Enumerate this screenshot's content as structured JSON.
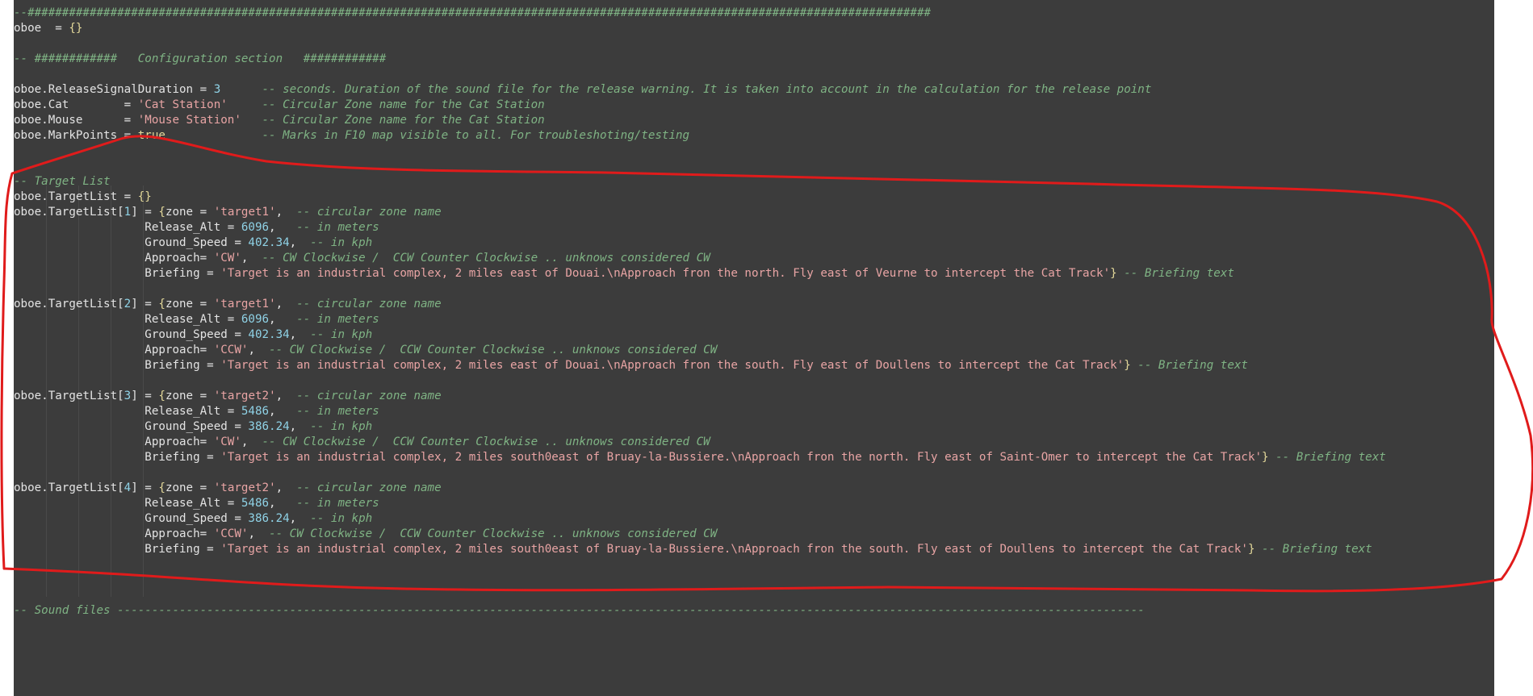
{
  "editor": {
    "lines": [
      [
        {
          "c": "hd",
          "t": "--###################################################################################################################################"
        }
      ],
      [
        {
          "c": "i",
          "t": "oboe  = "
        },
        {
          "c": "k",
          "t": "{}"
        }
      ],
      [
        {
          "c": "i",
          "t": ""
        }
      ],
      [
        {
          "c": "hd",
          "t": "-- ############   Configuration section   ############"
        }
      ],
      [
        {
          "c": "i",
          "t": ""
        }
      ],
      [
        {
          "c": "i",
          "t": "oboe.ReleaseSignalDuration = "
        },
        {
          "c": "n",
          "t": "3"
        },
        {
          "c": "i",
          "t": "      "
        },
        {
          "c": "c",
          "t": "-- seconds. Duration of the sound file for the release warning. It is taken into account in the calculation for the release point"
        }
      ],
      [
        {
          "c": "i",
          "t": "oboe.Cat        = "
        },
        {
          "c": "s",
          "t": "'Cat Station'"
        },
        {
          "c": "i",
          "t": "     "
        },
        {
          "c": "c",
          "t": "-- Circular Zone name for the Cat Station"
        }
      ],
      [
        {
          "c": "i",
          "t": "oboe.Mouse      = "
        },
        {
          "c": "s",
          "t": "'Mouse Station'"
        },
        {
          "c": "i",
          "t": "   "
        },
        {
          "c": "c",
          "t": "-- Circular Zone name for the Cat Station"
        }
      ],
      [
        {
          "c": "i",
          "t": "oboe.MarkPoints = "
        },
        {
          "c": "k",
          "t": "true"
        },
        {
          "c": "i",
          "t": "              "
        },
        {
          "c": "c",
          "t": "-- Marks in F10 map visible to all. For troubleshoting/testing"
        }
      ],
      [
        {
          "c": "i",
          "t": ""
        }
      ],
      [
        {
          "c": "i",
          "t": ""
        }
      ],
      [
        {
          "c": "c",
          "t": "-- Target List"
        }
      ],
      [
        {
          "c": "i",
          "t": "oboe.TargetList = "
        },
        {
          "c": "k",
          "t": "{}"
        }
      ],
      [
        {
          "c": "i",
          "t": "oboe.TargetList["
        },
        {
          "c": "n",
          "t": "1"
        },
        {
          "c": "i",
          "t": "] = "
        },
        {
          "c": "k",
          "t": "{"
        },
        {
          "c": "i",
          "t": "zone = "
        },
        {
          "c": "s",
          "t": "'target1'"
        },
        {
          "c": "i",
          "t": ",  "
        },
        {
          "c": "c",
          "t": "-- circular zone name"
        }
      ],
      [
        {
          "c": "i",
          "t": "                   Release_Alt = "
        },
        {
          "c": "n",
          "t": "6096"
        },
        {
          "c": "i",
          "t": ",   "
        },
        {
          "c": "c",
          "t": "-- in meters"
        }
      ],
      [
        {
          "c": "i",
          "t": "                   Ground_Speed = "
        },
        {
          "c": "n",
          "t": "402.34"
        },
        {
          "c": "i",
          "t": ",  "
        },
        {
          "c": "c",
          "t": "-- in kph"
        }
      ],
      [
        {
          "c": "i",
          "t": "                   Approach= "
        },
        {
          "c": "s",
          "t": "'CW'"
        },
        {
          "c": "i",
          "t": ",  "
        },
        {
          "c": "c",
          "t": "-- CW Clockwise /  CCW Counter Clockwise .. unknows considered CW"
        }
      ],
      [
        {
          "c": "i",
          "t": "                   Briefing = "
        },
        {
          "c": "s",
          "t": "'Target is an industrial complex, 2 miles east of Douai.\\nApproach fron the north. Fly east of Veurne to intercept the Cat Track'"
        },
        {
          "c": "k",
          "t": "}"
        },
        {
          "c": "i",
          "t": " "
        },
        {
          "c": "c",
          "t": "-- Briefing text"
        }
      ],
      [
        {
          "c": "i",
          "t": ""
        }
      ],
      [
        {
          "c": "i",
          "t": "oboe.TargetList["
        },
        {
          "c": "n",
          "t": "2"
        },
        {
          "c": "i",
          "t": "] = "
        },
        {
          "c": "k",
          "t": "{"
        },
        {
          "c": "i",
          "t": "zone = "
        },
        {
          "c": "s",
          "t": "'target1'"
        },
        {
          "c": "i",
          "t": ",  "
        },
        {
          "c": "c",
          "t": "-- circular zone name"
        }
      ],
      [
        {
          "c": "i",
          "t": "                   Release_Alt = "
        },
        {
          "c": "n",
          "t": "6096"
        },
        {
          "c": "i",
          "t": ",   "
        },
        {
          "c": "c",
          "t": "-- in meters"
        }
      ],
      [
        {
          "c": "i",
          "t": "                   Ground_Speed = "
        },
        {
          "c": "n",
          "t": "402.34"
        },
        {
          "c": "i",
          "t": ",  "
        },
        {
          "c": "c",
          "t": "-- in kph"
        }
      ],
      [
        {
          "c": "i",
          "t": "                   Approach= "
        },
        {
          "c": "s",
          "t": "'CCW'"
        },
        {
          "c": "i",
          "t": ",  "
        },
        {
          "c": "c",
          "t": "-- CW Clockwise /  CCW Counter Clockwise .. unknows considered CW"
        }
      ],
      [
        {
          "c": "i",
          "t": "                   Briefing = "
        },
        {
          "c": "s",
          "t": "'Target is an industrial complex, 2 miles east of Douai.\\nApproach fron the south. Fly east of Doullens to intercept the Cat Track'"
        },
        {
          "c": "k",
          "t": "}"
        },
        {
          "c": "i",
          "t": " "
        },
        {
          "c": "c",
          "t": "-- Briefing text"
        }
      ],
      [
        {
          "c": "i",
          "t": ""
        }
      ],
      [
        {
          "c": "i",
          "t": "oboe.TargetList["
        },
        {
          "c": "n",
          "t": "3"
        },
        {
          "c": "i",
          "t": "] = "
        },
        {
          "c": "k",
          "t": "{"
        },
        {
          "c": "i",
          "t": "zone = "
        },
        {
          "c": "s",
          "t": "'target2'"
        },
        {
          "c": "i",
          "t": ",  "
        },
        {
          "c": "c",
          "t": "-- circular zone name"
        }
      ],
      [
        {
          "c": "i",
          "t": "                   Release_Alt = "
        },
        {
          "c": "n",
          "t": "5486"
        },
        {
          "c": "i",
          "t": ",   "
        },
        {
          "c": "c",
          "t": "-- in meters"
        }
      ],
      [
        {
          "c": "i",
          "t": "                   Ground_Speed = "
        },
        {
          "c": "n",
          "t": "386.24"
        },
        {
          "c": "i",
          "t": ",  "
        },
        {
          "c": "c",
          "t": "-- in kph"
        }
      ],
      [
        {
          "c": "i",
          "t": "                   Approach= "
        },
        {
          "c": "s",
          "t": "'CW'"
        },
        {
          "c": "i",
          "t": ",  "
        },
        {
          "c": "c",
          "t": "-- CW Clockwise /  CCW Counter Clockwise .. unknows considered CW"
        }
      ],
      [
        {
          "c": "i",
          "t": "                   Briefing = "
        },
        {
          "c": "s",
          "t": "'Target is an industrial complex, 2 miles south0east of Bruay-la-Bussiere.\\nApproach fron the north. Fly east of Saint-Omer to intercept the Cat Track'"
        },
        {
          "c": "k",
          "t": "}"
        },
        {
          "c": "i",
          "t": " "
        },
        {
          "c": "c",
          "t": "-- Briefing text"
        }
      ],
      [
        {
          "c": "i",
          "t": ""
        }
      ],
      [
        {
          "c": "i",
          "t": "oboe.TargetList["
        },
        {
          "c": "n",
          "t": "4"
        },
        {
          "c": "i",
          "t": "] = "
        },
        {
          "c": "k",
          "t": "{"
        },
        {
          "c": "i",
          "t": "zone = "
        },
        {
          "c": "s",
          "t": "'target2'"
        },
        {
          "c": "i",
          "t": ",  "
        },
        {
          "c": "c",
          "t": "-- circular zone name"
        }
      ],
      [
        {
          "c": "i",
          "t": "                   Release_Alt = "
        },
        {
          "c": "n",
          "t": "5486"
        },
        {
          "c": "i",
          "t": ",   "
        },
        {
          "c": "c",
          "t": "-- in meters"
        }
      ],
      [
        {
          "c": "i",
          "t": "                   Ground_Speed = "
        },
        {
          "c": "n",
          "t": "386.24"
        },
        {
          "c": "i",
          "t": ",  "
        },
        {
          "c": "c",
          "t": "-- in kph"
        }
      ],
      [
        {
          "c": "i",
          "t": "                   Approach= "
        },
        {
          "c": "s",
          "t": "'CCW'"
        },
        {
          "c": "i",
          "t": ",  "
        },
        {
          "c": "c",
          "t": "-- CW Clockwise /  CCW Counter Clockwise .. unknows considered CW"
        }
      ],
      [
        {
          "c": "i",
          "t": "                   Briefing = "
        },
        {
          "c": "s",
          "t": "'Target is an industrial complex, 2 miles south0east of Bruay-la-Bussiere.\\nApproach fron the south. Fly east of Doullens to intercept the Cat Track'"
        },
        {
          "c": "k",
          "t": "}"
        },
        {
          "c": "i",
          "t": " "
        },
        {
          "c": "c",
          "t": "-- Briefing text"
        }
      ],
      [
        {
          "c": "i",
          "t": ""
        }
      ],
      [
        {
          "c": "i",
          "t": ""
        }
      ],
      [
        {
          "c": "i",
          "t": ""
        }
      ],
      [
        {
          "c": "c",
          "t": "-- Sound files -----------------------------------------------------------------------------------------------------------------------------------------------------"
        }
      ]
    ]
  },
  "colors": {
    "background": "#3c3c3c",
    "annotation": "#e01b1b"
  }
}
